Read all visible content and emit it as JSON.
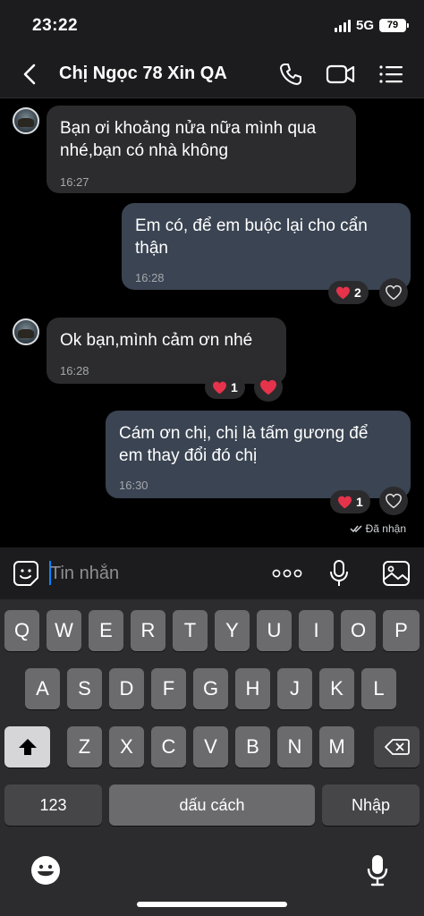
{
  "status": {
    "time": "23:22",
    "network": "5G",
    "battery": "79"
  },
  "header": {
    "title": "Chị Ngọc 78 Xin QA"
  },
  "messages": [
    {
      "direction": "in",
      "lines": [
        "Bạn ơi khoảng nửa nữa mình qua",
        "nhé,bạn có nhà không"
      ],
      "time": "16:27"
    },
    {
      "direction": "out",
      "lines": [
        "Em có, để em buộc lại cho cẩn",
        "thận"
      ],
      "time": "16:28",
      "reaction_count": "2"
    },
    {
      "direction": "in",
      "lines": [
        "Ok bạn,mình cảm ơn nhé"
      ],
      "time": "16:28",
      "reaction_count": "1"
    },
    {
      "direction": "out",
      "lines": [
        "Cám ơn chị, chị là tấm gương để",
        "em thay đổi đó chị"
      ],
      "time": "16:30",
      "reaction_count": "1"
    }
  ],
  "delivered_label": "Đã nhận",
  "composer": {
    "placeholder": "Tin nhắn"
  },
  "keyboard": {
    "row1": [
      "Q",
      "W",
      "E",
      "R",
      "T",
      "Y",
      "U",
      "I",
      "O",
      "P"
    ],
    "row2": [
      "A",
      "S",
      "D",
      "F",
      "G",
      "H",
      "J",
      "K",
      "L"
    ],
    "row3": [
      "Z",
      "X",
      "C",
      "V",
      "B",
      "N",
      "M"
    ],
    "numbers_label": "123",
    "space_label": "dấu cách",
    "return_label": "Nhập"
  },
  "colors": {
    "incoming_bubble": "#2c2c2e",
    "outgoing_bubble": "#3a4452",
    "heart": "#e5334b"
  }
}
